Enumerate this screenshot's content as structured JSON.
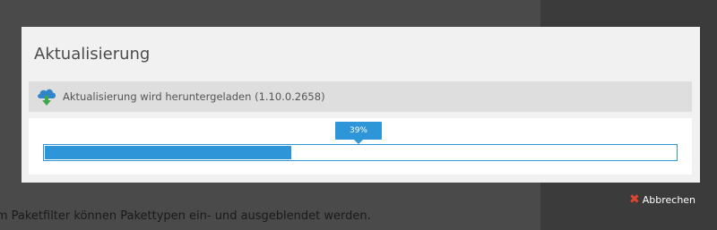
{
  "background": {
    "text": "Im Paketfilter können Pakettypen ein- und ausgeblendet werden."
  },
  "dialog": {
    "title": "Aktualisierung",
    "status": {
      "icon": "cloud-download-icon",
      "text": "Aktualisierung wird heruntergeladen (1.10.0.2658)"
    },
    "progress": {
      "value": 0.39,
      "label": "39%"
    }
  },
  "actions": {
    "cancel_icon": "close-icon",
    "cancel_label": "Abbrechen"
  },
  "colors": {
    "accent": "#2e95d8",
    "cancel_red": "#e0452f",
    "dialog_bg": "#f1f1f1",
    "status_bar_bg": "#dedede"
  }
}
